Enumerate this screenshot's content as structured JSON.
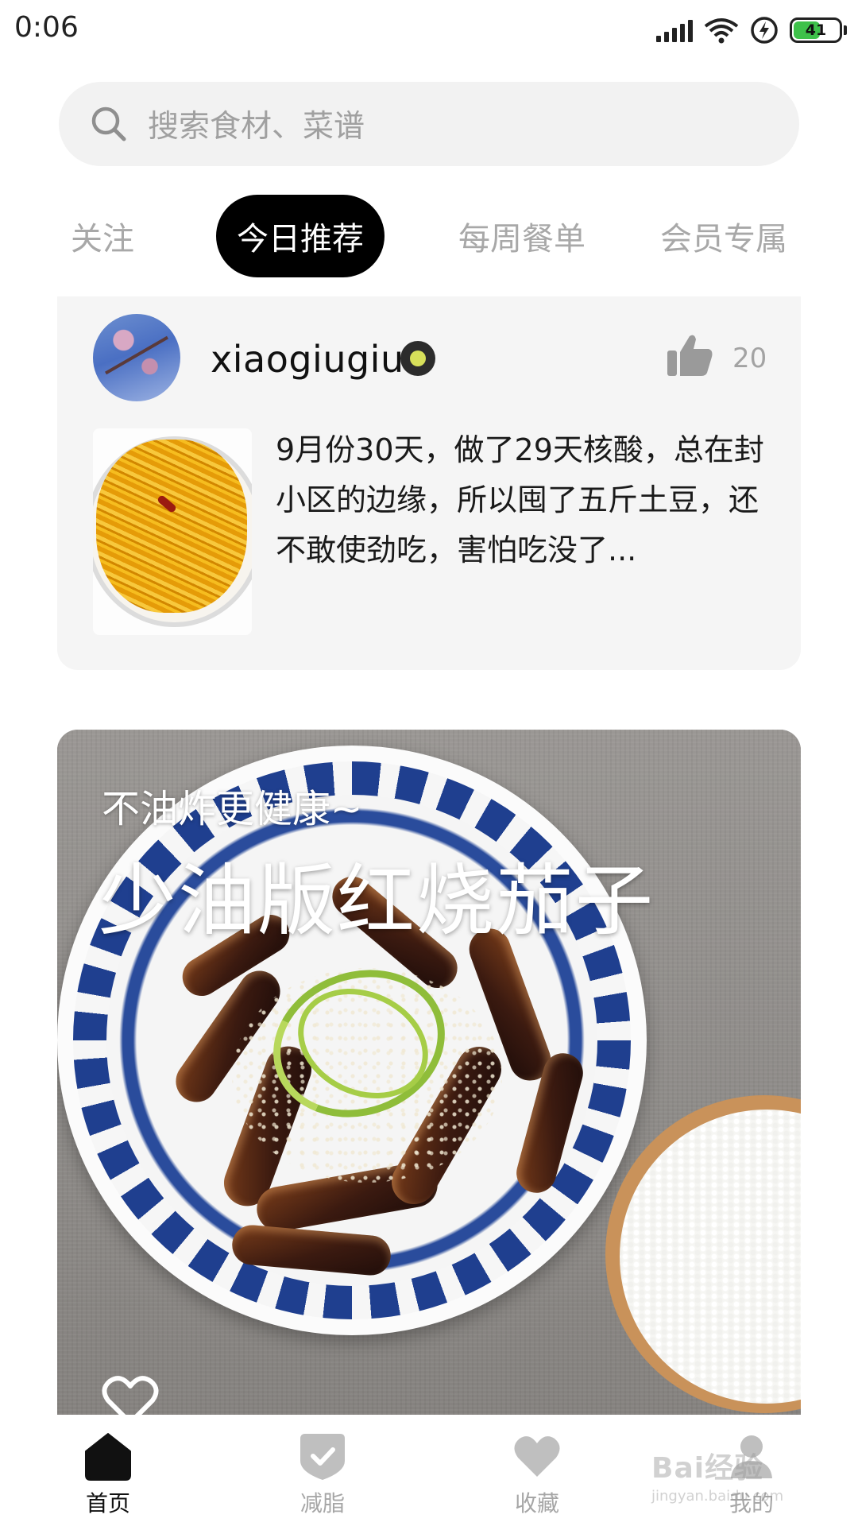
{
  "status_bar": {
    "time": "0:06",
    "battery": "41",
    "icons": [
      "signal-icon",
      "wifi-icon",
      "charging-icon",
      "battery-icon"
    ]
  },
  "search": {
    "placeholder": "搜索食材、菜谱"
  },
  "tabs": [
    {
      "label": "关注",
      "active": false
    },
    {
      "label": "今日推荐",
      "active": true
    },
    {
      "label": "每周餐单",
      "active": false
    },
    {
      "label": "会员专属",
      "active": false
    }
  ],
  "post": {
    "username": "xiaogiugiu",
    "likes": "20",
    "text": "9月份30天，做了29天核酸，总在封小区的边缘，所以囤了五斤土豆，还不敢使劲吃，害怕吃没了..."
  },
  "recipe": {
    "subtitle": "不油炸更健康~",
    "title": "少油版红烧茄子"
  },
  "bottom_nav": [
    {
      "label": "首页",
      "icon": "home-icon",
      "active": true
    },
    {
      "label": "减脂",
      "icon": "shield-check-icon",
      "active": false
    },
    {
      "label": "收藏",
      "icon": "heart-icon",
      "active": false
    },
    {
      "label": "我的",
      "icon": "profile-icon",
      "active": false
    }
  ],
  "watermark": {
    "text": "Bai经验",
    "sub": "jingyan.baidu.com"
  },
  "colors": {
    "active_tab_bg": "#000000",
    "inactive_text": "#a8a8a8",
    "card_bg": "#f5f5f5",
    "battery_green": "#3ec14a"
  }
}
